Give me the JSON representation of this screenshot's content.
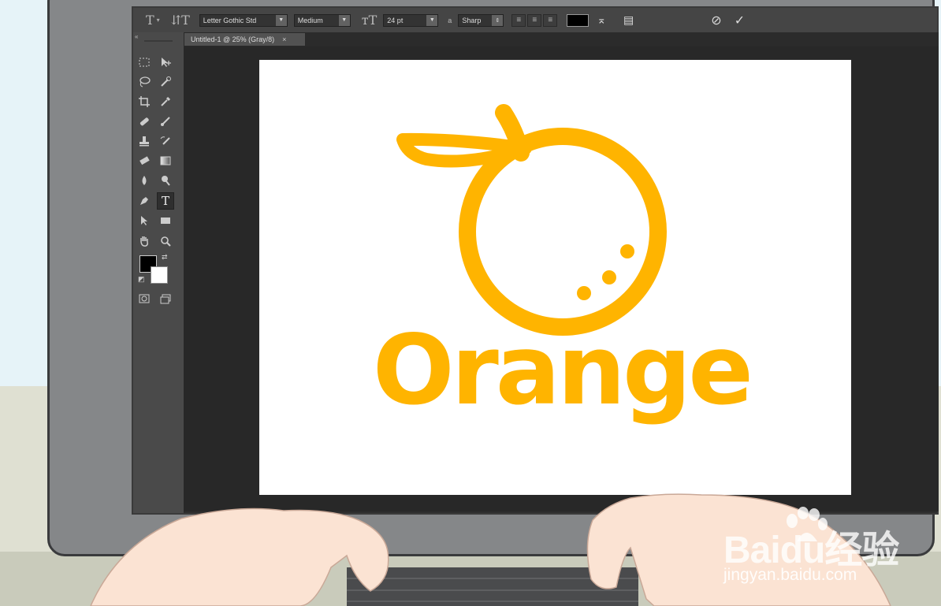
{
  "options_bar": {
    "font_family": "Letter Gothic Std",
    "font_style": "Medium",
    "font_size": "24 pt",
    "aa_label": "a",
    "antialias": "Sharp",
    "text_color": "#000000"
  },
  "document": {
    "tab_title": "Untitled-1 @ 25% (Gray/8)",
    "close_glyph": "×"
  },
  "artwork": {
    "word": "Orange",
    "accent_color": "#ffb400"
  },
  "watermark": {
    "main": "Baidu经验",
    "url": "jingyan.baidu.com"
  }
}
